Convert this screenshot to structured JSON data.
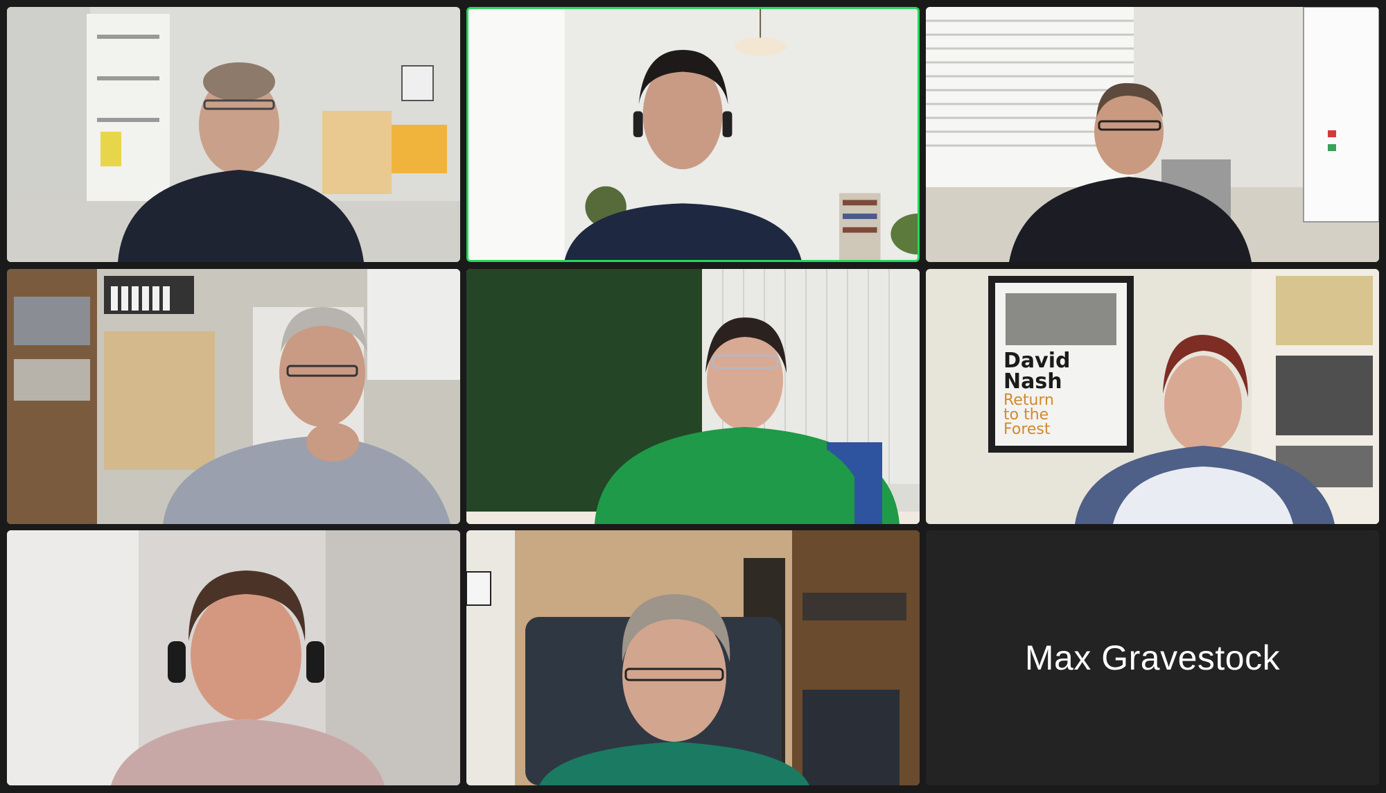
{
  "meeting": {
    "view": "gallery",
    "active_speaker_tile": 2,
    "active_speaker_color": "#23d95a",
    "background_color": "#1a1a1a"
  },
  "participants": [
    {
      "tile": 1,
      "video": "on"
    },
    {
      "tile": 2,
      "video": "on",
      "speaking": true
    },
    {
      "tile": 3,
      "video": "on"
    },
    {
      "tile": 4,
      "video": "on"
    },
    {
      "tile": 5,
      "video": "on"
    },
    {
      "tile": 6,
      "video": "on"
    },
    {
      "tile": 7,
      "video": "on"
    },
    {
      "tile": 8,
      "video": "on"
    },
    {
      "tile": 9,
      "video": "off",
      "name": "Max Gravestock"
    }
  ],
  "poster": {
    "line1": "David",
    "line2": "Nash",
    "line3": "Return",
    "line4": "to the",
    "line5": "Forest"
  }
}
